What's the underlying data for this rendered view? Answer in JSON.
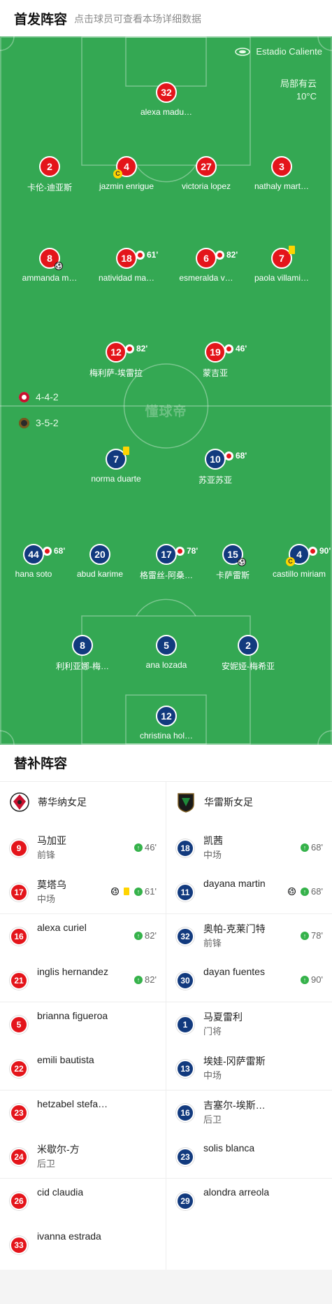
{
  "header": {
    "title": "首发阵容",
    "hint": "点击球员可查看本场详细数据"
  },
  "field": {
    "stadium": "Estadio Caliente",
    "weather": "局部有云",
    "temperature": "10°C",
    "watermark": "懂球帝",
    "colors": {
      "pitch": "#34a853",
      "home": "#e4151b",
      "away": "#123a7e"
    }
  },
  "formations": {
    "home": "4-4-2",
    "away": "3-5-2"
  },
  "home_lineup": [
    {
      "num": "32",
      "name": "alexa madu…"
    },
    {
      "num": "2",
      "name": "卡伦-迪亚斯"
    },
    {
      "num": "4",
      "name": "jazmin enrigue",
      "captain": "C"
    },
    {
      "num": "27",
      "name": "victoria lopez"
    },
    {
      "num": "3",
      "name": "nathaly mart…"
    },
    {
      "num": "8",
      "name": "ammanda m…",
      "goal": true
    },
    {
      "num": "18",
      "name": "natividad ma…",
      "sub_out": "61'"
    },
    {
      "num": "6",
      "name": "esmeralda v…",
      "sub_out": "82'"
    },
    {
      "num": "7",
      "name": "paola villami…",
      "yellow": true
    },
    {
      "num": "12",
      "name": "梅利萨-埃雷拉",
      "sub_out": "82'"
    },
    {
      "num": "19",
      "name": "蒙吉亚",
      "sub_out": "46'"
    }
  ],
  "away_lineup": [
    {
      "num": "7",
      "name": "norma duarte",
      "yellow": true
    },
    {
      "num": "10",
      "name": "苏亚苏亚",
      "sub_out": "68'"
    },
    {
      "num": "44",
      "name": "hana soto",
      "sub_out": "68'"
    },
    {
      "num": "20",
      "name": "abud karime"
    },
    {
      "num": "17",
      "name": "格雷丝-阿桑…",
      "sub_out": "78'"
    },
    {
      "num": "15",
      "name": "卡萨雷斯",
      "goal": true
    },
    {
      "num": "4",
      "name": "castillo miriam",
      "sub_out": "90'",
      "captain": "C"
    },
    {
      "num": "8",
      "name": "利利亚娜-梅…"
    },
    {
      "num": "5",
      "name": "ana lozada"
    },
    {
      "num": "2",
      "name": "安妮娅-梅希亚"
    },
    {
      "num": "12",
      "name": "christina hol…"
    }
  ],
  "subs": {
    "title": "替补阵容",
    "home_team": "蒂华纳女足",
    "away_team": "华雷斯女足",
    "home": [
      {
        "num": "9",
        "name": "马加亚",
        "pos": "前锋",
        "in": "46'"
      },
      {
        "num": "17",
        "name": "莫塔乌",
        "pos": "中场",
        "in": "61'",
        "goal": true,
        "yellow": true
      },
      {
        "num": "16",
        "name": "alexa curiel",
        "pos": "",
        "in": "82'"
      },
      {
        "num": "21",
        "name": "inglis hernandez",
        "pos": "",
        "in": "82'"
      },
      {
        "num": "5",
        "name": "brianna figueroa",
        "pos": ""
      },
      {
        "num": "22",
        "name": "emili bautista",
        "pos": ""
      },
      {
        "num": "23",
        "name": "hetzabel stefa…",
        "pos": ""
      },
      {
        "num": "24",
        "name": "米歇尔-方",
        "pos": "后卫"
      },
      {
        "num": "26",
        "name": "cid claudia",
        "pos": ""
      },
      {
        "num": "33",
        "name": "ivanna estrada",
        "pos": ""
      }
    ],
    "away": [
      {
        "num": "18",
        "name": "凯茜",
        "pos": "中场",
        "in": "68'"
      },
      {
        "num": "11",
        "name": "dayana martin",
        "pos": "",
        "in": "68'",
        "goal": true
      },
      {
        "num": "32",
        "name": "奥帕-克莱门特",
        "pos": "前锋",
        "in": "78'"
      },
      {
        "num": "30",
        "name": "dayan fuentes",
        "pos": "",
        "in": "90'"
      },
      {
        "num": "1",
        "name": "马夏雷利",
        "pos": "门将"
      },
      {
        "num": "13",
        "name": "埃娃-冈萨雷斯",
        "pos": "中场"
      },
      {
        "num": "16",
        "name": "吉塞尔-埃斯…",
        "pos": "后卫"
      },
      {
        "num": "23",
        "name": "solis blanca",
        "pos": ""
      },
      {
        "num": "29",
        "name": "alondra arreola",
        "pos": ""
      }
    ]
  }
}
